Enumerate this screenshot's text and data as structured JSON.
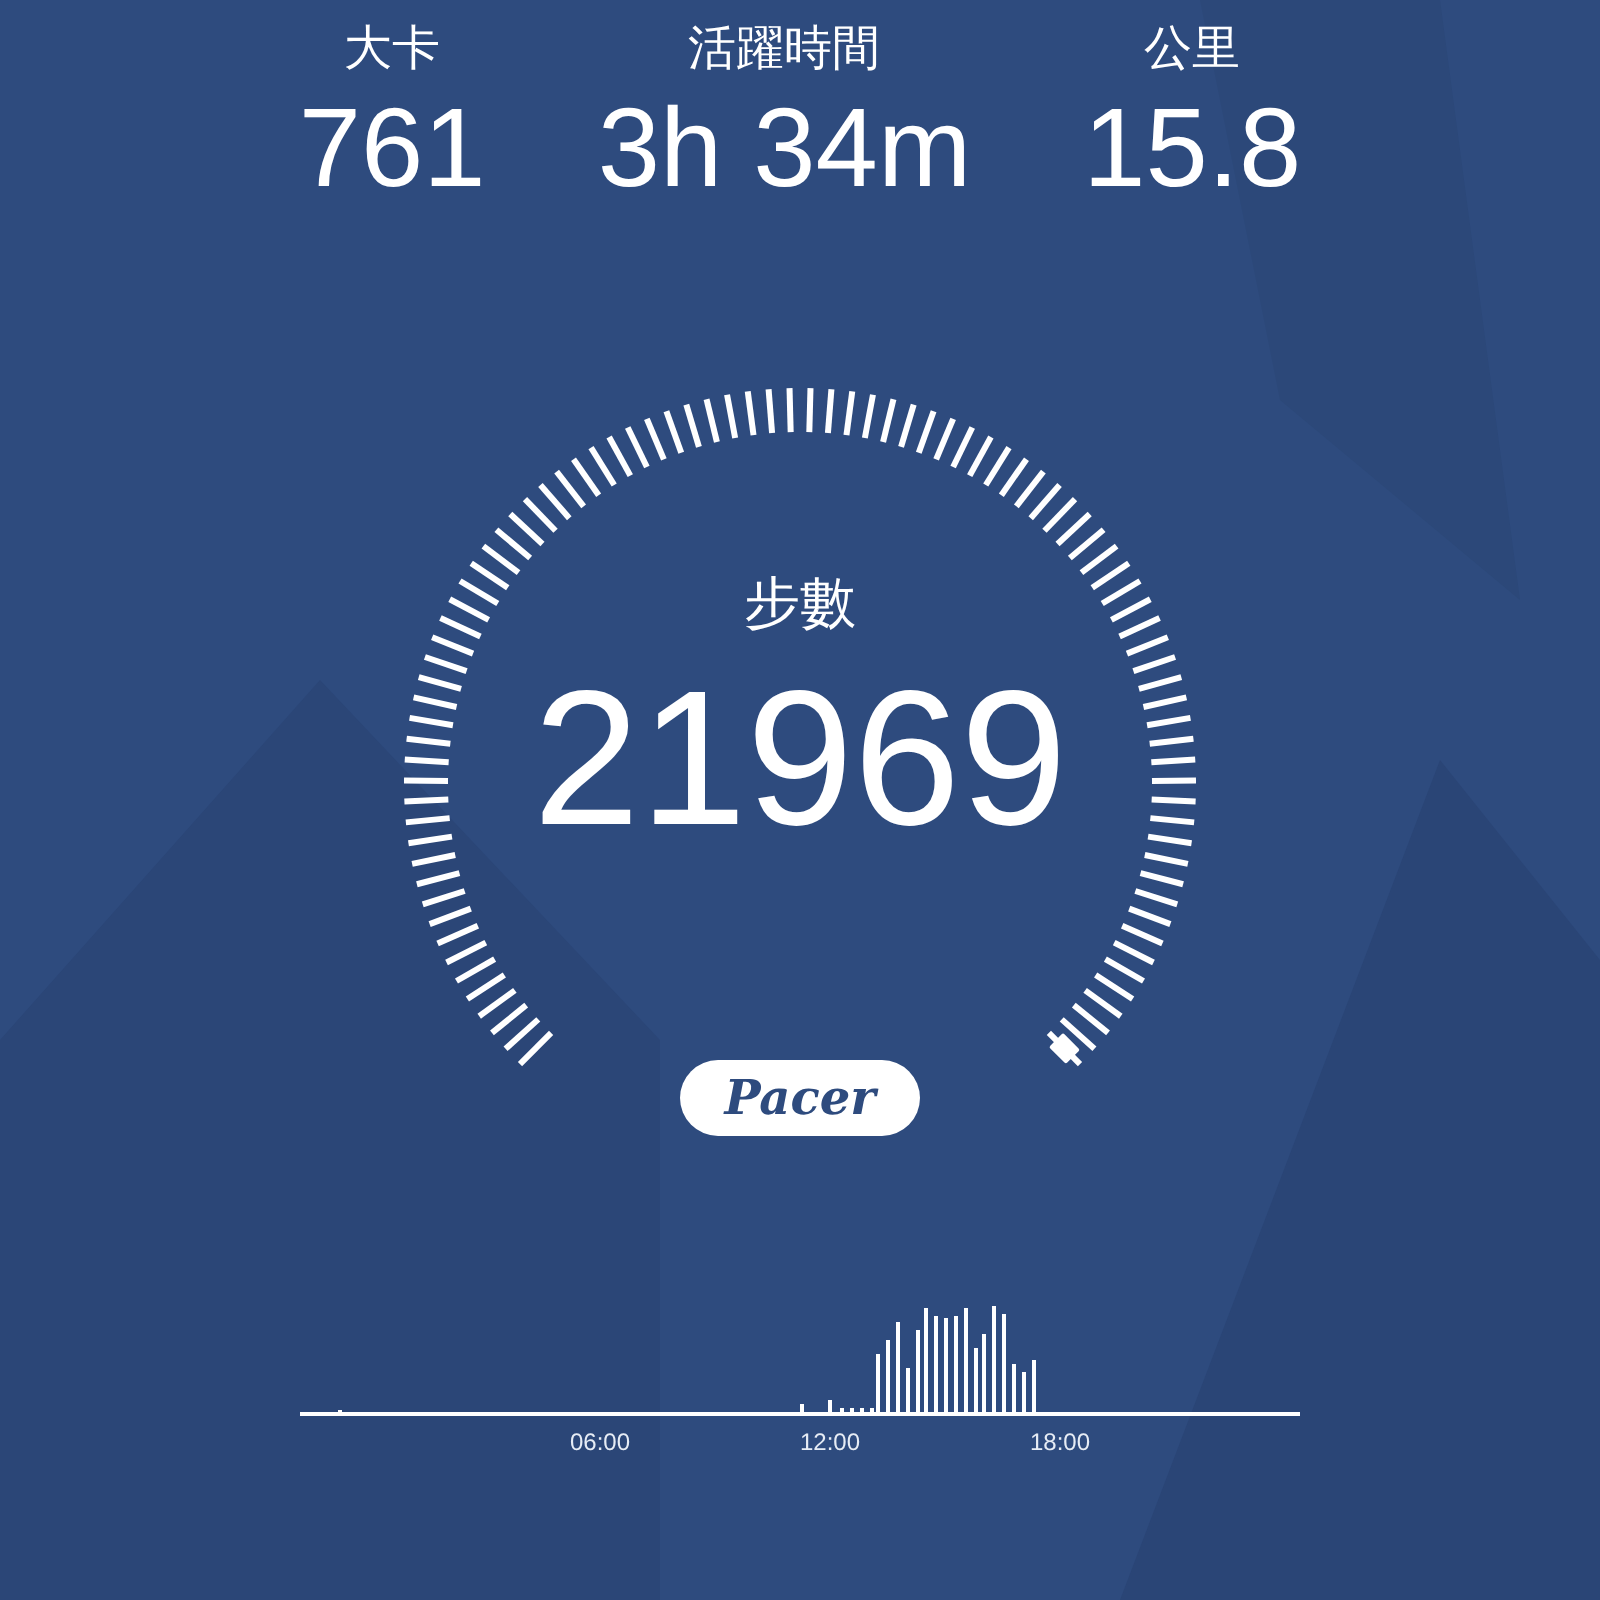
{
  "stats": [
    {
      "label": "大卡",
      "value": "761"
    },
    {
      "label": "活躍時間",
      "value": "3h 34m"
    },
    {
      "label": "公里",
      "value": "15.8"
    }
  ],
  "steps": {
    "label": "步數",
    "value": "21969"
  },
  "brand": "Pacer",
  "activity": {
    "time_labels": [
      "06:00",
      "12:00",
      "18:00"
    ]
  }
}
